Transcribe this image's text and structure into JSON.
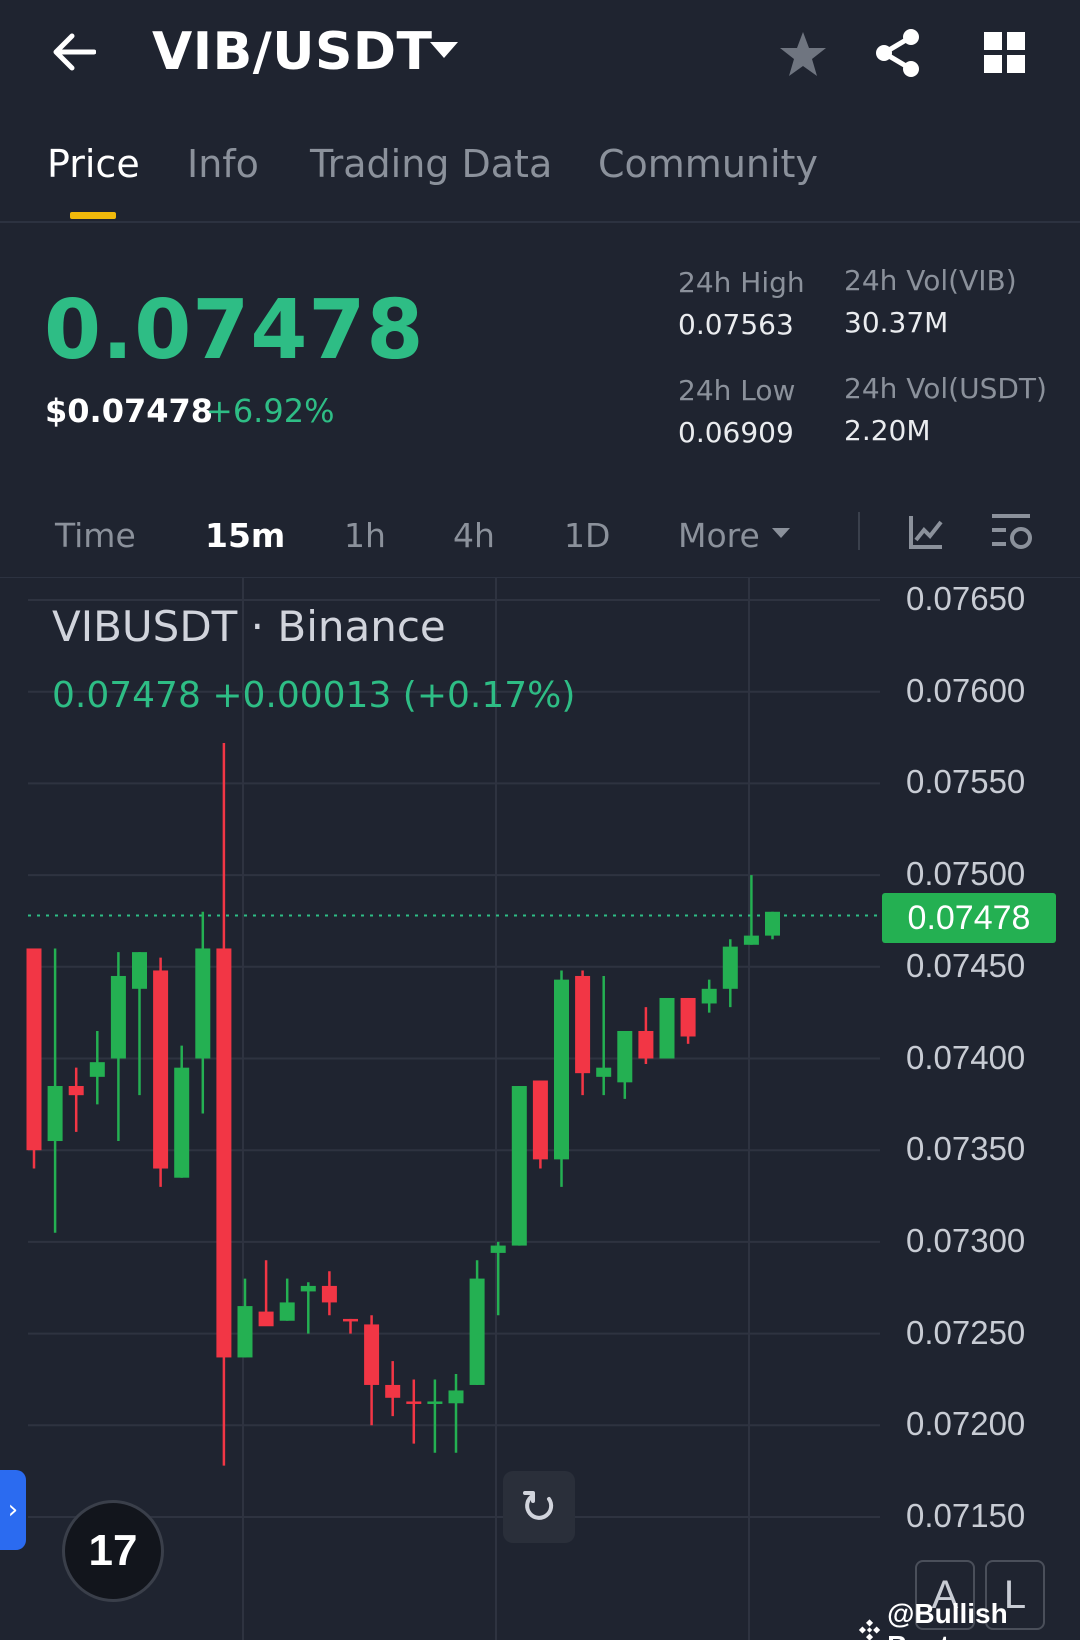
{
  "header": {
    "title": "VIB/USDT",
    "icons": [
      "back-arrow-icon",
      "chevron-down-icon",
      "star-icon",
      "share-icon",
      "grid-icon"
    ]
  },
  "tabs": [
    "Price",
    "Info",
    "Trading Data",
    "Community"
  ],
  "price": {
    "last": "0.07478",
    "usd": "$0.07478",
    "change_pct": "+6.92%",
    "high_label": "24h High",
    "high": "0.07563",
    "low_label": "24h Low",
    "low": "0.06909",
    "vol_base_label": "24h Vol(VIB)",
    "vol_base": "30.37M",
    "vol_quote_label": "24h Vol(USDT)",
    "vol_quote": "2.20M"
  },
  "intervals": {
    "time": "Time",
    "m15": "15m",
    "h1": "1h",
    "h4": "4h",
    "d1": "1D",
    "more": "More"
  },
  "colors": {
    "up": "#2ebd85",
    "down": "#f6465d",
    "accent": "#f0b90b",
    "candle_up": "#24b052",
    "candle_down": "#f23645"
  },
  "chart_data": {
    "type": "candlestick",
    "title": "VIBUSDT · Binance",
    "subtitle": "0.07478  +0.00013 (+0.17%)",
    "y_ticks": [
      "0.07650",
      "0.07600",
      "0.07550",
      "0.07500",
      "0.07450",
      "0.07400",
      "0.07350",
      "0.07300",
      "0.07250",
      "0.07200",
      "0.07150"
    ],
    "ylim": [
      0.0712,
      0.0766
    ],
    "last_price_label": "0.07478",
    "last_price": 0.07478,
    "candles": [
      {
        "o": 0.0746,
        "h": 0.0746,
        "l": 0.0734,
        "c": 0.0735
      },
      {
        "o": 0.07355,
        "h": 0.0746,
        "l": 0.07305,
        "c": 0.07385
      },
      {
        "o": 0.07385,
        "h": 0.07395,
        "l": 0.0736,
        "c": 0.0738
      },
      {
        "o": 0.0739,
        "h": 0.07415,
        "l": 0.07375,
        "c": 0.07398
      },
      {
        "o": 0.074,
        "h": 0.07458,
        "l": 0.07355,
        "c": 0.07445
      },
      {
        "o": 0.07438,
        "h": 0.07458,
        "l": 0.0738,
        "c": 0.07458
      },
      {
        "o": 0.07448,
        "h": 0.07455,
        "l": 0.0733,
        "c": 0.0734
      },
      {
        "o": 0.07335,
        "h": 0.07407,
        "l": 0.07335,
        "c": 0.07395
      },
      {
        "o": 0.074,
        "h": 0.0748,
        "l": 0.0737,
        "c": 0.0746
      },
      {
        "o": 0.0746,
        "h": 0.07572,
        "l": 0.07178,
        "c": 0.07237
      },
      {
        "o": 0.07237,
        "h": 0.0728,
        "l": 0.07237,
        "c": 0.07265
      },
      {
        "o": 0.07262,
        "h": 0.0729,
        "l": 0.07257,
        "c": 0.07254
      },
      {
        "o": 0.07257,
        "h": 0.0728,
        "l": 0.07257,
        "c": 0.07267
      },
      {
        "o": 0.07273,
        "h": 0.07278,
        "l": 0.0725,
        "c": 0.07276
      },
      {
        "o": 0.07276,
        "h": 0.07284,
        "l": 0.0726,
        "c": 0.07267
      },
      {
        "o": 0.07258,
        "h": 0.07258,
        "l": 0.0725,
        "c": 0.07257
      },
      {
        "o": 0.07255,
        "h": 0.0726,
        "l": 0.072,
        "c": 0.07222
      },
      {
        "o": 0.07222,
        "h": 0.07235,
        "l": 0.07205,
        "c": 0.07215
      },
      {
        "o": 0.07213,
        "h": 0.07225,
        "l": 0.0719,
        "c": 0.07212
      },
      {
        "o": 0.07213,
        "h": 0.07225,
        "l": 0.07185,
        "c": 0.07213
      },
      {
        "o": 0.07212,
        "h": 0.07228,
        "l": 0.07185,
        "c": 0.07219
      },
      {
        "o": 0.07222,
        "h": 0.0729,
        "l": 0.07222,
        "c": 0.0728
      },
      {
        "o": 0.07294,
        "h": 0.073,
        "l": 0.0726,
        "c": 0.07298
      },
      {
        "o": 0.07298,
        "h": 0.07385,
        "l": 0.07298,
        "c": 0.07385
      },
      {
        "o": 0.07388,
        "h": 0.07388,
        "l": 0.0734,
        "c": 0.07345
      },
      {
        "o": 0.07345,
        "h": 0.07448,
        "l": 0.0733,
        "c": 0.07443
      },
      {
        "o": 0.07445,
        "h": 0.07448,
        "l": 0.0738,
        "c": 0.07392
      },
      {
        "o": 0.0739,
        "h": 0.07445,
        "l": 0.0738,
        "c": 0.07395
      },
      {
        "o": 0.07387,
        "h": 0.07415,
        "l": 0.07378,
        "c": 0.07415
      },
      {
        "o": 0.07415,
        "h": 0.07428,
        "l": 0.07397,
        "c": 0.074
      },
      {
        "o": 0.074,
        "h": 0.0743,
        "l": 0.074,
        "c": 0.07433
      },
      {
        "o": 0.07433,
        "h": 0.07433,
        "l": 0.07408,
        "c": 0.07412
      },
      {
        "o": 0.0743,
        "h": 0.07443,
        "l": 0.07425,
        "c": 0.07438
      },
      {
        "o": 0.07438,
        "h": 0.07465,
        "l": 0.07428,
        "c": 0.07461
      },
      {
        "o": 0.07462,
        "h": 0.075,
        "l": 0.07462,
        "c": 0.07467
      },
      {
        "o": 0.07467,
        "h": 0.0748,
        "l": 0.07465,
        "c": 0.0748
      }
    ]
  },
  "controls": {
    "side_tab": "›",
    "tv_logo": "17",
    "mode_a": "A",
    "mode_l": "L"
  },
  "watermark": "@Bullish Buster"
}
